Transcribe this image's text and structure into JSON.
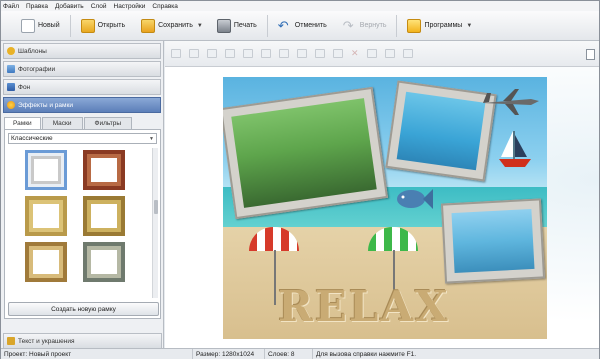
{
  "menu": [
    "Файл",
    "Правка",
    "Добавить",
    "Слой",
    "Настройки",
    "Справка"
  ],
  "toolbar": {
    "new_label": "Новый",
    "open_label": "Открыть",
    "save_label": "Сохранить",
    "print_label": "Печать",
    "undo_label": "Отменить",
    "redo_label": "Вернуть",
    "programs_label": "Программы"
  },
  "sidebar": {
    "sections": [
      "Шаблоны",
      "Фотографии",
      "Фон",
      "Эффекты и рамки"
    ],
    "tabs": [
      "Рамки",
      "Маски",
      "Фильтры"
    ],
    "frame_style": "Классические",
    "create_button": "Создать новую рамку",
    "bottom_section": "Текст и украшения"
  },
  "canvas": {
    "relax_text": "RELAX"
  },
  "status": {
    "project": "Проект: Новый проект",
    "size": "Размер: 1280x1024",
    "layers": "Слоев: 8",
    "help": "Для вызова справки нажмите F1."
  },
  "colors": {
    "accent": "#5c7fb9",
    "sky": "#5ab3e0",
    "sea": "#3dbcc4",
    "sand": "#d8bf8e"
  }
}
